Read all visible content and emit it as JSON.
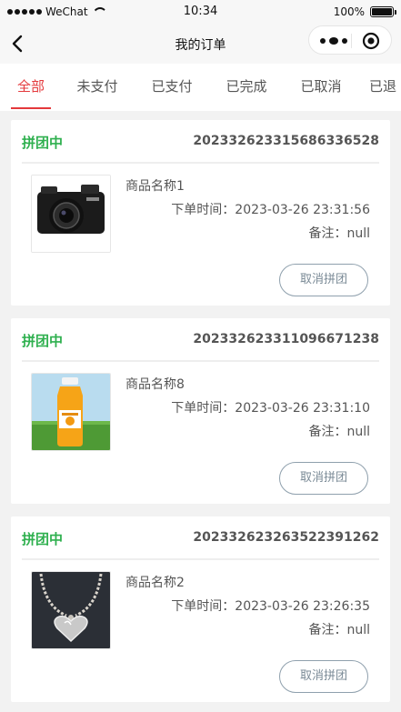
{
  "status_bar": {
    "carrier": "WeChat",
    "time": "10:34",
    "battery": "100%"
  },
  "nav": {
    "title": "我的订单"
  },
  "tabs": [
    {
      "label": "全部",
      "active": true
    },
    {
      "label": "未支付",
      "active": false
    },
    {
      "label": "已支付",
      "active": false
    },
    {
      "label": "已完成",
      "active": false
    },
    {
      "label": "已取消",
      "active": false
    },
    {
      "label": "已退",
      "active": false
    }
  ],
  "orders": [
    {
      "status": "拼团中",
      "order_no": "20233262331568633652​8",
      "product_name": "商品名称1",
      "order_time": "下单时间：2023-03-26 23:31:56",
      "remark": "备注：null",
      "action": "取消拼团",
      "thumb": "camera"
    },
    {
      "status": "拼团中",
      "order_no": "20233262331109667123​8",
      "product_name": "商品名称8",
      "order_time": "下单时间：2023-03-26 23:31:10",
      "remark": "备注：null",
      "action": "取消拼团",
      "thumb": "juice-bottle"
    },
    {
      "status": "拼团中",
      "order_no": "20233262326352239126​2",
      "product_name": "商品名称2",
      "order_time": "下单时间：2023-03-26 23:26:35",
      "remark": "备注：null",
      "action": "取消拼团",
      "thumb": "heart-necklace"
    }
  ],
  "colors": {
    "accent": "#e4393c",
    "status_green": "#2fb04f",
    "button_border": "#8fa0ad"
  }
}
